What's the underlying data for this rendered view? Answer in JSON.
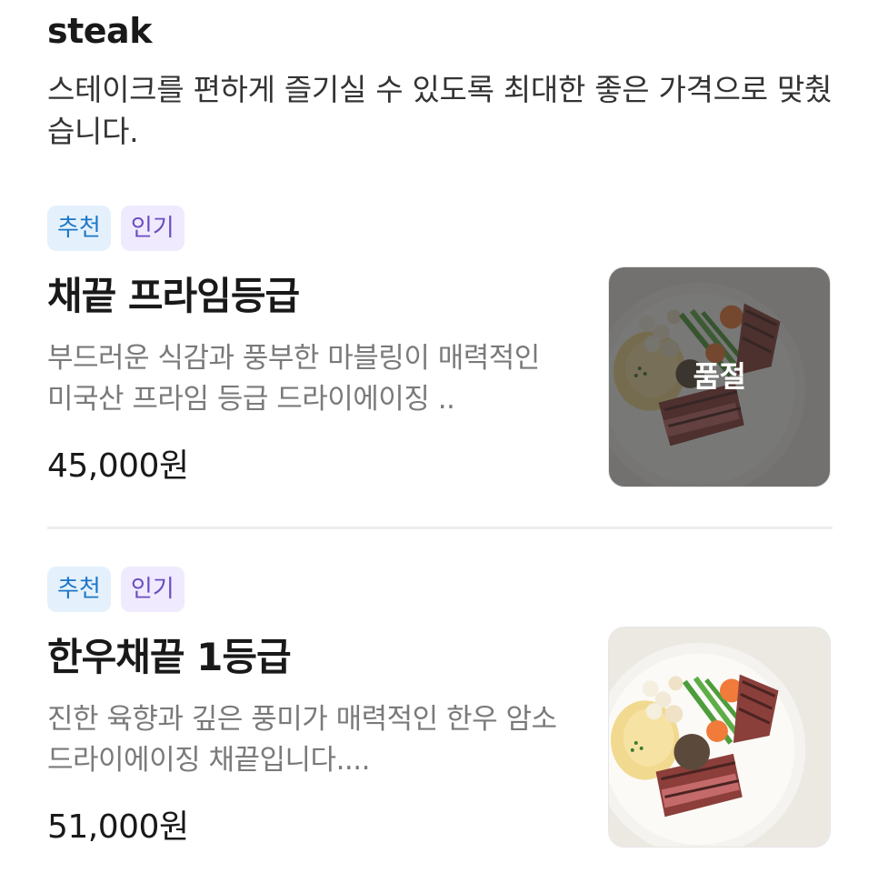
{
  "section": {
    "title": "steak",
    "description": "스테이크를 편하게 즐기실 수 있도록 최대한 좋은 가격으로 맞췄습니다."
  },
  "items": [
    {
      "badges": [
        "추천",
        "인기"
      ],
      "name": "채끝 프라임등급",
      "description": "부드러운 식감과 풍부한 마블링이 매력적인 미국산 프라임 등급 드라이에이징 ..",
      "price": "45,000원",
      "sold_out": true,
      "sold_out_label": "품절"
    },
    {
      "badges": [
        "추천",
        "인기"
      ],
      "name": "한우채끝 1등급",
      "description": "진한 육향과 깊은 풍미가 매력적인 한우 암소 드라이에이징 채끝입니다....",
      "price": "51,000원",
      "sold_out": false
    }
  ],
  "colors": {
    "recommend_badge_bg": "#e4f1fc",
    "recommend_badge_text": "#1d76c7",
    "popular_badge_bg": "#efeafd",
    "popular_badge_text": "#6b4bc1"
  }
}
